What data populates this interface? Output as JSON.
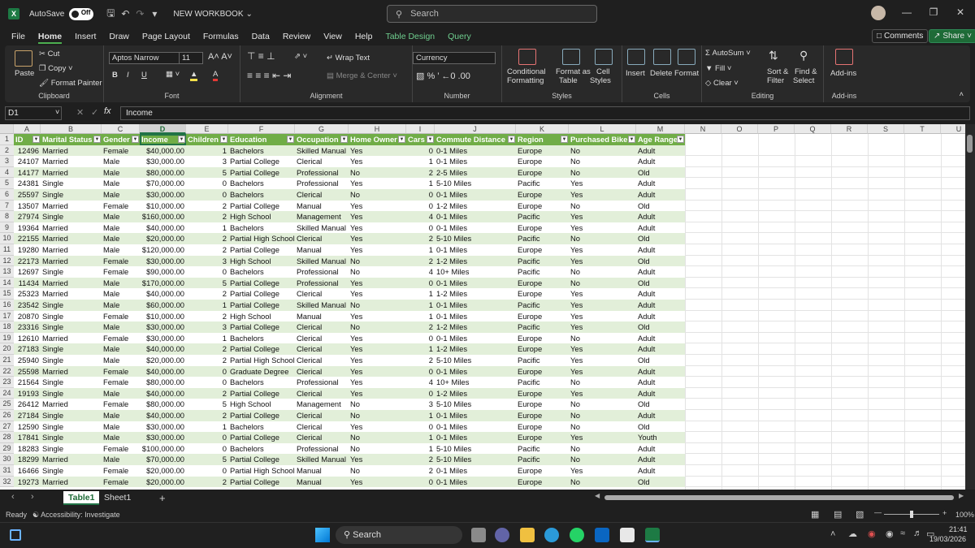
{
  "titlebar": {
    "autosave": "AutoSave",
    "toggle": "Off",
    "workbook": "NEW WORKBOOK",
    "search_placeholder": "Search"
  },
  "menu": [
    "File",
    "Home",
    "Insert",
    "Draw",
    "Page Layout",
    "Formulas",
    "Data",
    "Review",
    "View",
    "Help",
    "Table Design",
    "Query"
  ],
  "header_buttons": {
    "comments": "Comments",
    "share": "Share"
  },
  "ribbon": {
    "clipboard": {
      "paste": "Paste",
      "cut": "Cut",
      "copy": "Copy",
      "format_painter": "Format Painter",
      "label": "Clipboard"
    },
    "font": {
      "name": "Aptos Narrow",
      "size": "11",
      "label": "Font",
      "bold": "B",
      "italic": "I",
      "underline": "U"
    },
    "alignment": {
      "wrap": "Wrap Text",
      "merge": "Merge & Center",
      "label": "Alignment"
    },
    "number": {
      "format": "Currency",
      "label": "Number"
    },
    "styles": {
      "conditional": "Conditional",
      "conditional2": "Formatting",
      "format_as": "Format as",
      "format_as2": "Table",
      "cell": "Cell",
      "cell2": "Styles",
      "label": "Styles"
    },
    "cells": {
      "insert": "Insert",
      "delete": "Delete",
      "format": "Format",
      "label": "Cells"
    },
    "editing": {
      "autosum": "AutoSum",
      "fill": "Fill",
      "clear": "Clear",
      "sort": "Sort &",
      "sort2": "Filter",
      "find": "Find &",
      "find2": "Select",
      "label": "Editing"
    },
    "addins": {
      "addins": "Add-ins",
      "label": "Add-ins"
    }
  },
  "formula_bar": {
    "name_box": "D1",
    "formula": "Income"
  },
  "columns": [
    "A",
    "B",
    "C",
    "D",
    "E",
    "F",
    "G",
    "H",
    "I",
    "J",
    "K",
    "L",
    "M",
    "N",
    "O",
    "P",
    "Q",
    "R",
    "S",
    "T",
    "U"
  ],
  "table_headers": [
    "ID",
    "Marital Status",
    "Gender",
    "Income",
    "Children",
    "Education",
    "Occupation",
    "Home Owner",
    "Cars",
    "Commute Distance",
    "Region",
    "Purchased Bike",
    "Age Range"
  ],
  "rows": [
    [
      "12496",
      "Married",
      "Female",
      "$40,000.00",
      "1",
      "Bachelors",
      "Skilled Manual",
      "Yes",
      "0",
      "0-1 Miles",
      "Europe",
      "No",
      "Adult"
    ],
    [
      "24107",
      "Married",
      "Male",
      "$30,000.00",
      "3",
      "Partial College",
      "Clerical",
      "Yes",
      "1",
      "0-1 Miles",
      "Europe",
      "No",
      "Adult"
    ],
    [
      "14177",
      "Married",
      "Male",
      "$80,000.00",
      "5",
      "Partial College",
      "Professional",
      "No",
      "2",
      "2-5 Miles",
      "Europe",
      "No",
      "Old"
    ],
    [
      "24381",
      "Single",
      "Male",
      "$70,000.00",
      "0",
      "Bachelors",
      "Professional",
      "Yes",
      "1",
      "5-10 Miles",
      "Pacific",
      "Yes",
      "Adult"
    ],
    [
      "25597",
      "Single",
      "Male",
      "$30,000.00",
      "0",
      "Bachelors",
      "Clerical",
      "No",
      "0",
      "0-1 Miles",
      "Europe",
      "Yes",
      "Adult"
    ],
    [
      "13507",
      "Married",
      "Female",
      "$10,000.00",
      "2",
      "Partial College",
      "Manual",
      "Yes",
      "0",
      "1-2 Miles",
      "Europe",
      "No",
      "Old"
    ],
    [
      "27974",
      "Single",
      "Male",
      "$160,000.00",
      "2",
      "High School",
      "Management",
      "Yes",
      "4",
      "0-1 Miles",
      "Pacific",
      "Yes",
      "Adult"
    ],
    [
      "19364",
      "Married",
      "Male",
      "$40,000.00",
      "1",
      "Bachelors",
      "Skilled Manual",
      "Yes",
      "0",
      "0-1 Miles",
      "Europe",
      "Yes",
      "Adult"
    ],
    [
      "22155",
      "Married",
      "Male",
      "$20,000.00",
      "2",
      "Partial High School",
      "Clerical",
      "Yes",
      "2",
      "5-10 Miles",
      "Pacific",
      "No",
      "Old"
    ],
    [
      "19280",
      "Married",
      "Male",
      "$120,000.00",
      "2",
      "Partial College",
      "Manual",
      "Yes",
      "1",
      "0-1 Miles",
      "Europe",
      "Yes",
      "Adult"
    ],
    [
      "22173",
      "Married",
      "Female",
      "$30,000.00",
      "3",
      "High School",
      "Skilled Manual",
      "No",
      "2",
      "1-2 Miles",
      "Pacific",
      "Yes",
      "Old"
    ],
    [
      "12697",
      "Single",
      "Female",
      "$90,000.00",
      "0",
      "Bachelors",
      "Professional",
      "No",
      "4",
      "10+ Miles",
      "Pacific",
      "No",
      "Adult"
    ],
    [
      "11434",
      "Married",
      "Male",
      "$170,000.00",
      "5",
      "Partial College",
      "Professional",
      "Yes",
      "0",
      "0-1 Miles",
      "Europe",
      "No",
      "Old"
    ],
    [
      "25323",
      "Married",
      "Male",
      "$40,000.00",
      "2",
      "Partial College",
      "Clerical",
      "Yes",
      "1",
      "1-2 Miles",
      "Europe",
      "Yes",
      "Adult"
    ],
    [
      "23542",
      "Single",
      "Male",
      "$60,000.00",
      "1",
      "Partial College",
      "Skilled Manual",
      "No",
      "1",
      "0-1 Miles",
      "Pacific",
      "Yes",
      "Adult"
    ],
    [
      "20870",
      "Single",
      "Female",
      "$10,000.00",
      "2",
      "High School",
      "Manual",
      "Yes",
      "1",
      "0-1 Miles",
      "Europe",
      "Yes",
      "Adult"
    ],
    [
      "23316",
      "Single",
      "Male",
      "$30,000.00",
      "3",
      "Partial College",
      "Clerical",
      "No",
      "2",
      "1-2 Miles",
      "Pacific",
      "Yes",
      "Old"
    ],
    [
      "12610",
      "Married",
      "Female",
      "$30,000.00",
      "1",
      "Bachelors",
      "Clerical",
      "Yes",
      "0",
      "0-1 Miles",
      "Europe",
      "No",
      "Adult"
    ],
    [
      "27183",
      "Single",
      "Male",
      "$40,000.00",
      "2",
      "Partial College",
      "Clerical",
      "Yes",
      "1",
      "1-2 Miles",
      "Europe",
      "Yes",
      "Adult"
    ],
    [
      "25940",
      "Single",
      "Male",
      "$20,000.00",
      "2",
      "Partial High School",
      "Clerical",
      "Yes",
      "2",
      "5-10 Miles",
      "Pacific",
      "Yes",
      "Old"
    ],
    [
      "25598",
      "Married",
      "Female",
      "$40,000.00",
      "0",
      "Graduate Degree",
      "Clerical",
      "Yes",
      "0",
      "0-1 Miles",
      "Europe",
      "Yes",
      "Adult"
    ],
    [
      "21564",
      "Single",
      "Female",
      "$80,000.00",
      "0",
      "Bachelors",
      "Professional",
      "Yes",
      "4",
      "10+ Miles",
      "Pacific",
      "No",
      "Adult"
    ],
    [
      "19193",
      "Single",
      "Male",
      "$40,000.00",
      "2",
      "Partial College",
      "Clerical",
      "Yes",
      "0",
      "1-2 Miles",
      "Europe",
      "Yes",
      "Adult"
    ],
    [
      "26412",
      "Married",
      "Female",
      "$80,000.00",
      "5",
      "High School",
      "Management",
      "No",
      "3",
      "5-10 Miles",
      "Europe",
      "No",
      "Old"
    ],
    [
      "27184",
      "Single",
      "Male",
      "$40,000.00",
      "2",
      "Partial College",
      "Clerical",
      "No",
      "1",
      "0-1 Miles",
      "Europe",
      "No",
      "Adult"
    ],
    [
      "12590",
      "Single",
      "Male",
      "$30,000.00",
      "1",
      "Bachelors",
      "Clerical",
      "Yes",
      "0",
      "0-1 Miles",
      "Europe",
      "No",
      "Old"
    ],
    [
      "17841",
      "Single",
      "Male",
      "$30,000.00",
      "0",
      "Partial College",
      "Clerical",
      "No",
      "1",
      "0-1 Miles",
      "Europe",
      "Yes",
      "Youth"
    ],
    [
      "18283",
      "Single",
      "Female",
      "$100,000.00",
      "0",
      "Bachelors",
      "Professional",
      "No",
      "1",
      "5-10 Miles",
      "Pacific",
      "No",
      "Adult"
    ],
    [
      "18299",
      "Married",
      "Male",
      "$70,000.00",
      "5",
      "Partial College",
      "Skilled Manual",
      "Yes",
      "2",
      "5-10 Miles",
      "Pacific",
      "No",
      "Adult"
    ],
    [
      "16466",
      "Single",
      "Female",
      "$20,000.00",
      "0",
      "Partial High School",
      "Manual",
      "No",
      "2",
      "0-1 Miles",
      "Europe",
      "Yes",
      "Adult"
    ],
    [
      "19273",
      "Married",
      "Female",
      "$20,000.00",
      "2",
      "Partial College",
      "Manual",
      "Yes",
      "0",
      "0-1 Miles",
      "Europe",
      "No",
      "Old"
    ]
  ],
  "sheets": [
    "Table1",
    "Sheet1"
  ],
  "status": {
    "ready": "Ready",
    "accessibility": "Accessibility: Investigate",
    "zoom": "100%"
  },
  "taskbar": {
    "search": "Search",
    "time": "21:41",
    "date": "19/03/2026"
  },
  "colors": {
    "accent": "#217346",
    "table_header": "#70ad47",
    "band": "#e2efd9"
  }
}
